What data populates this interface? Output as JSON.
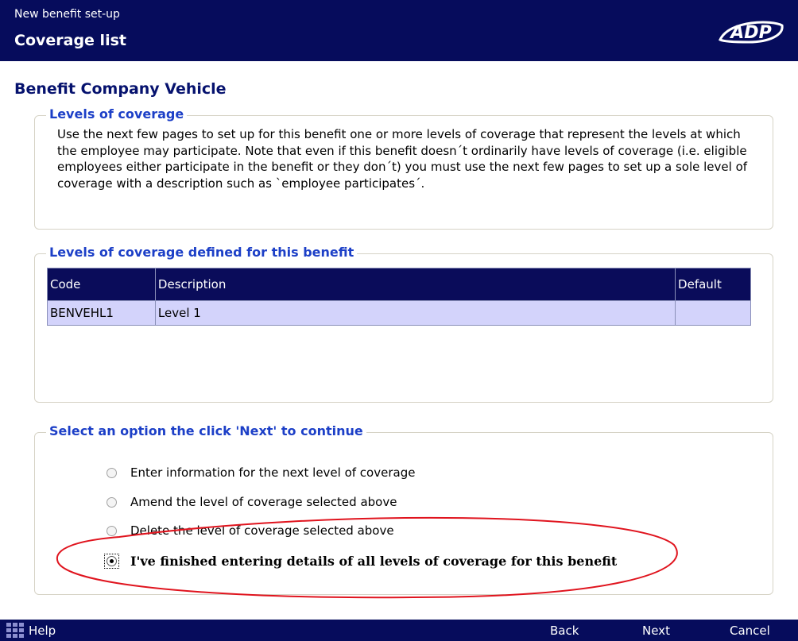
{
  "header": {
    "subtitle": "New benefit set-up",
    "title": "Coverage list",
    "logo_text": "ADP"
  },
  "benefit_title": "Benefit Company Vehicle",
  "levels_of_coverage": {
    "legend": "Levels of coverage",
    "paragraph": "Use the next few pages to set up for this benefit one or more levels of coverage that represent the levels at which the employee may participate. Note that even if this benefit doesn´t ordinarily have levels of coverage (i.e. eligible employees either participate in the benefit or they don´t) you must use the next few pages to set up a sole level of coverage with a description such as `employee participates´."
  },
  "defined_levels": {
    "legend": "Levels of coverage defined for this benefit",
    "columns": [
      "Code",
      "Description",
      "Default"
    ],
    "rows": [
      {
        "code": "BENVEHL1",
        "description": "Level 1",
        "default": ""
      }
    ]
  },
  "options": {
    "legend": "Select an option the click 'Next' to continue",
    "items": [
      {
        "label": "Enter information for the next level of coverage",
        "checked": false
      },
      {
        "label": "Amend the level of coverage selected above",
        "checked": false
      },
      {
        "label": "Delete the level of coverage selected above",
        "checked": false
      },
      {
        "label": "I've finished entering details of all levels of coverage for this benefit",
        "checked": true
      }
    ]
  },
  "footer": {
    "help": "Help",
    "back": "Back",
    "next": "Next",
    "cancel": "Cancel"
  },
  "colors": {
    "header_bg": "#060c5c",
    "legend_text": "#1c3fc7",
    "title_text": "#06126e",
    "table_row": "#d3d3fb",
    "annotation": "#e0141e"
  },
  "icons": [
    "adp-logo",
    "help-grid-icon",
    "radio-icon"
  ]
}
